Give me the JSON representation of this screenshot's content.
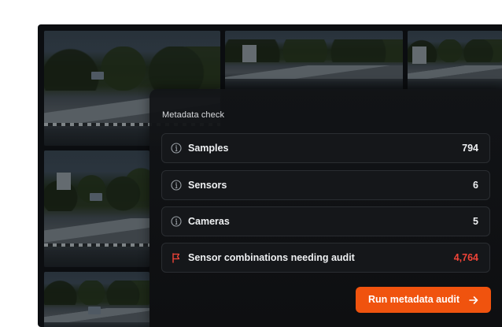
{
  "panel": {
    "title": "Metadata check",
    "rows": [
      {
        "label": "Samples",
        "value": "794",
        "icon": "info-icon"
      },
      {
        "label": "Sensors",
        "value": "6",
        "icon": "info-icon"
      },
      {
        "label": "Cameras",
        "value": "5",
        "icon": "info-icon"
      },
      {
        "label": "Sensor combinations needing audit",
        "value": "4,764",
        "icon": "flag-icon"
      }
    ],
    "action_label": "Run metadata audit",
    "action_icon": "arrow-right-icon"
  },
  "colors": {
    "accent": "#f0530e",
    "alert": "#f04438",
    "panel_bg": "#121417"
  }
}
